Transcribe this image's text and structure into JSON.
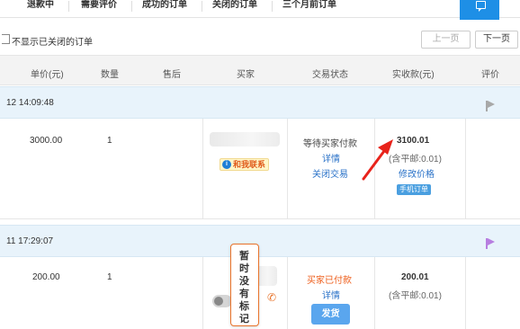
{
  "tabs": [
    {
      "label": "退款中"
    },
    {
      "label": "需要评价"
    },
    {
      "label": "成功的订单"
    },
    {
      "label": "关闭的订单"
    },
    {
      "label": "三个月前订单"
    }
  ],
  "filter": {
    "hide_closed_label": "不显示已关闭的订单",
    "hide_closed_checked": false
  },
  "pager": {
    "prev": "上一页",
    "next": "下一页"
  },
  "columns": [
    "单价(元)",
    "数量",
    "售后",
    "买家",
    "交易状态",
    "实收款(元)",
    "评价"
  ],
  "orders": [
    {
      "time": "12 14:09:48",
      "unit_price": "3000.00",
      "quantity": "1",
      "contact_label": "和我联系",
      "status": "等待买家付款",
      "detail_link": "详情",
      "close_link": "关闭交易",
      "amount": "3100.01",
      "shipping_note": "(含平邮:0.01)",
      "modify_price": "修改价格",
      "phone_order_tag": "手机订单",
      "flag_color": "#a8a8a8"
    },
    {
      "time": "11 17:29:07",
      "unit_price": "200.00",
      "quantity": "1",
      "status": "买家已付款",
      "detail_link": "详情",
      "ship_button": "发货",
      "amount": "200.01",
      "shipping_note": "(含平邮:0.01)",
      "flag_color": "#b77ee0",
      "note_tooltip": [
        "暂",
        "时",
        "没",
        "有",
        "标",
        "记"
      ]
    }
  ],
  "icons": {
    "feedback": "chat-bubble-icon",
    "wangwang": "wangwang-icon",
    "phone": "phone-icon",
    "flag": "flag-icon"
  },
  "colors": {
    "accent": "#1e8fe6",
    "status_paid": "#ee5d1a",
    "link": "#2a72c8",
    "annotation_arrow": "#e8231b"
  }
}
